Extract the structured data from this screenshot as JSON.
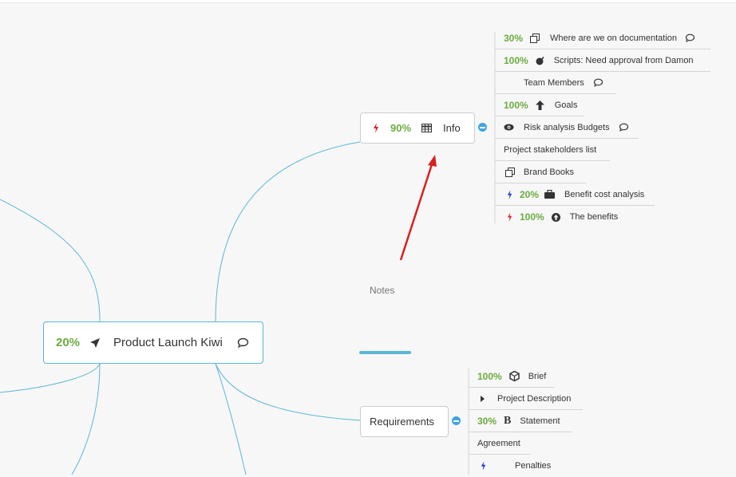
{
  "main_node": {
    "percent": "20%",
    "label": "Product Launch Kiwi"
  },
  "info_node": {
    "percent": "90%",
    "label": "Info"
  },
  "info_children": [
    {
      "percent": "30%",
      "label": "Where are we on documentation"
    },
    {
      "percent": "100%",
      "label": "Scripts: Need approval from Damon"
    },
    {
      "percent": "",
      "label": "Team Members"
    },
    {
      "percent": "100%",
      "label": "Goals"
    },
    {
      "percent": "",
      "label": "Risk analysis Budgets"
    },
    {
      "percent": "",
      "label": "Project stakeholders list"
    },
    {
      "percent": "",
      "label": "Brand Books"
    },
    {
      "percent": "20%",
      "label": "Benefit cost analysis"
    },
    {
      "percent": "100%",
      "label": "The benefits"
    }
  ],
  "notes_label": "Notes",
  "requirements_node": {
    "label": "Requirements"
  },
  "requirements_children": [
    {
      "percent": "100%",
      "label": "Brief"
    },
    {
      "percent": "",
      "label": "Project Description"
    },
    {
      "percent": "30%",
      "label": "Statement"
    },
    {
      "percent": "",
      "label": "Agreement"
    },
    {
      "percent": "",
      "label": "Penalties"
    }
  ],
  "colors": {
    "connector": "#5bb7d6",
    "percent": "#6aac3e",
    "annotation_arrow": "#d92020",
    "collapse_button": "#3ea5e0",
    "bolt_red": "#e02020",
    "bolt_blue": "#2030d0"
  }
}
